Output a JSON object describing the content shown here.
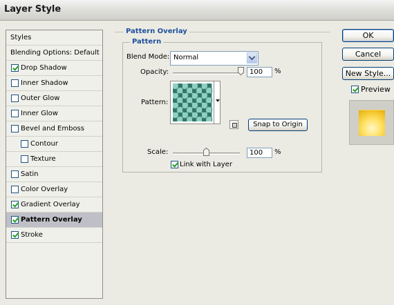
{
  "window": {
    "title": "Layer Style"
  },
  "styles_list": {
    "items": [
      {
        "label": "Styles",
        "type": "header"
      },
      {
        "label": "Blending Options: Default",
        "type": "header"
      },
      {
        "label": "Drop Shadow",
        "checked": true
      },
      {
        "label": "Inner Shadow",
        "checked": false
      },
      {
        "label": "Outer Glow",
        "checked": false
      },
      {
        "label": "Inner Glow",
        "checked": false
      },
      {
        "label": "Bevel and Emboss",
        "checked": false
      },
      {
        "label": "Contour",
        "checked": false,
        "indent": true
      },
      {
        "label": "Texture",
        "checked": false,
        "indent": true
      },
      {
        "label": "Satin",
        "checked": false
      },
      {
        "label": "Color Overlay",
        "checked": false
      },
      {
        "label": "Gradient Overlay",
        "checked": true
      },
      {
        "label": "Pattern Overlay",
        "checked": true,
        "selected": true
      },
      {
        "label": "Stroke",
        "checked": true
      }
    ]
  },
  "panel": {
    "section_title": "Pattern Overlay",
    "group_title": "Pattern",
    "blend_mode": {
      "label": "Blend Mode:",
      "value": "Normal"
    },
    "opacity": {
      "label": "Opacity:",
      "value": "100",
      "unit": "%",
      "level": 1.0
    },
    "pattern": {
      "label": "Pattern:",
      "snap_button": "Snap to Origin"
    },
    "scale": {
      "label": "Scale:",
      "value": "100",
      "unit": "%",
      "level": 0.5
    },
    "link_with_layer": {
      "label": "Link with Layer",
      "checked": true
    }
  },
  "buttons": {
    "ok": "OK",
    "cancel": "Cancel",
    "new_style": "New Style...",
    "preview": {
      "label": "Preview",
      "checked": true
    }
  },
  "colors": {
    "accent_title": "#1f4f9c",
    "pattern_swatch": "#4a9b8e",
    "preview_swatch": "#ffe36a"
  }
}
